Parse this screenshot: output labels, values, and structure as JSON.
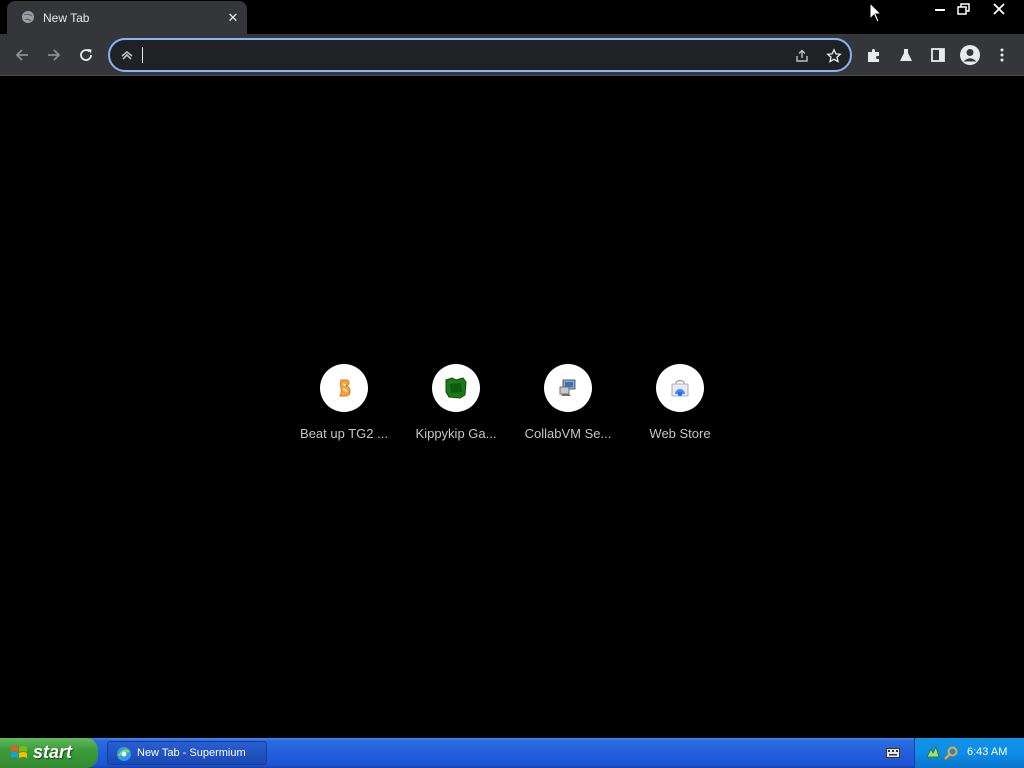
{
  "browser": {
    "tab": {
      "title": "New Tab"
    },
    "omnibox": {
      "value": "",
      "placeholder": ""
    }
  },
  "shortcuts": [
    {
      "label": "Beat up TG2 ...",
      "icon": "scratch-orange-icon"
    },
    {
      "label": "Kippykip Ga...",
      "icon": "green-square-icon"
    },
    {
      "label": "CollabVM Se...",
      "icon": "computer-icon"
    },
    {
      "label": "Web Store",
      "icon": "web-store-icon"
    }
  ],
  "taskbar": {
    "start_label": "start",
    "task_label": "New Tab - Supermium",
    "clock": "6:43 AM"
  },
  "colors": {
    "focus_ring": "#8ab4f8",
    "toolbar": "#35363a",
    "taskbar_blue": "#245edb",
    "start_green": "#3c9b3a"
  }
}
